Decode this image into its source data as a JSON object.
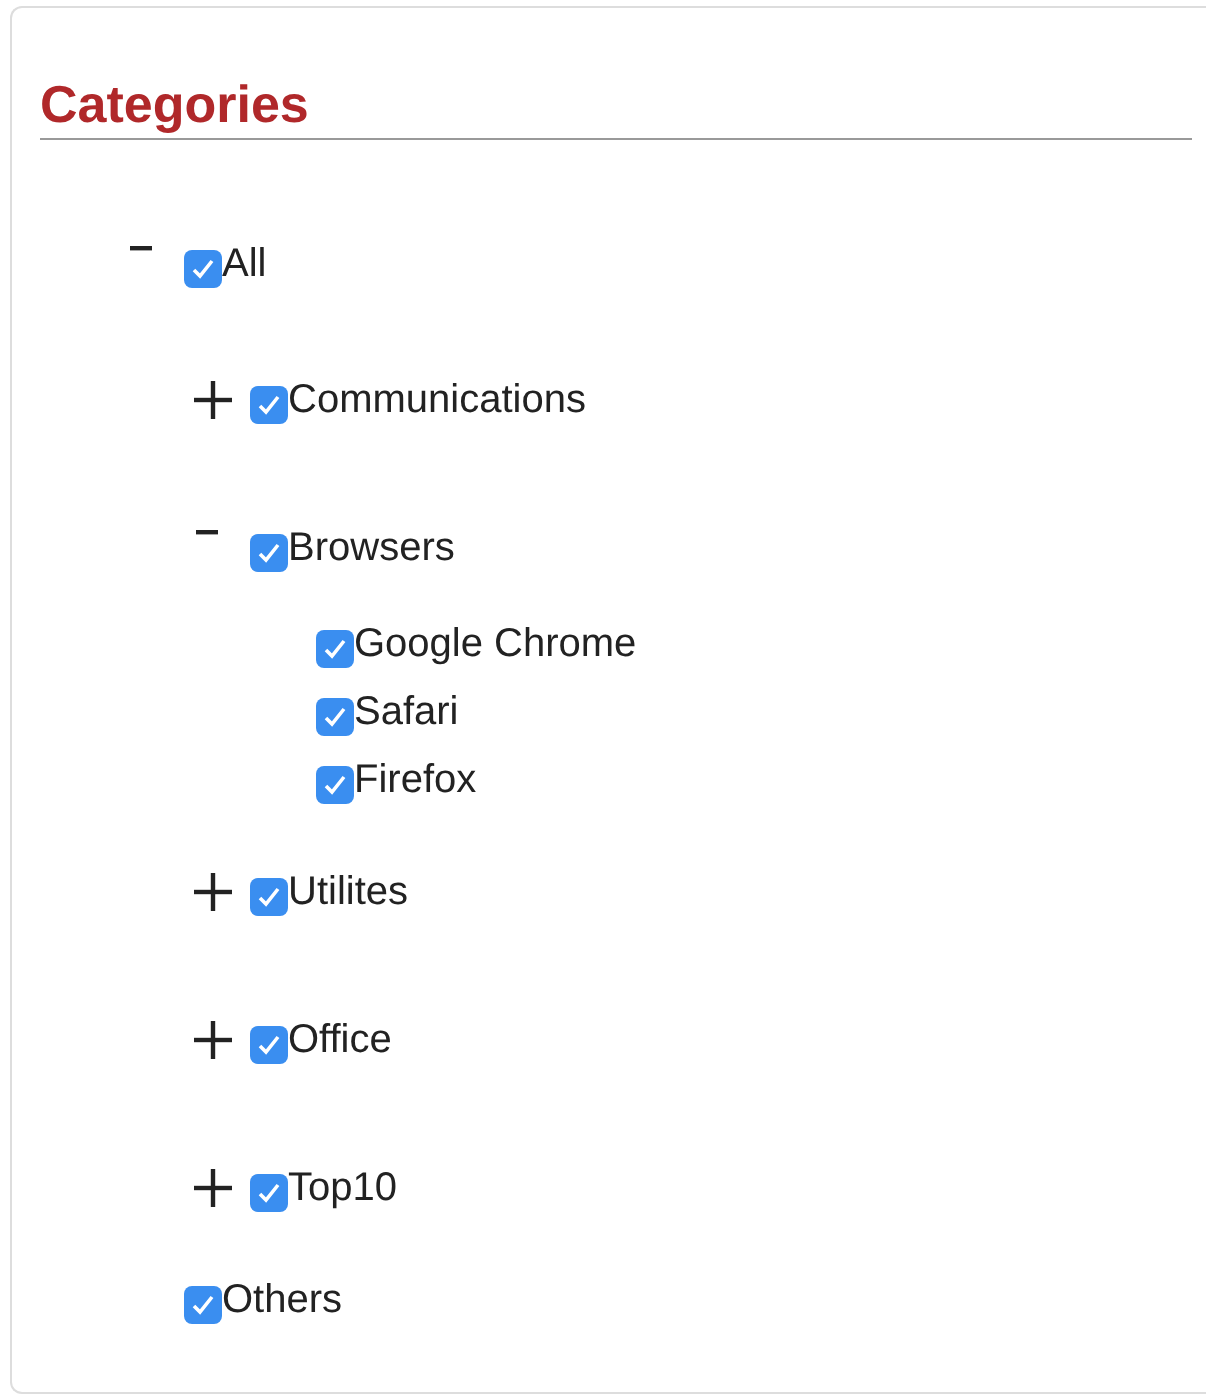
{
  "panel": {
    "title": "Categories",
    "tree": [
      {
        "label": "All",
        "checked": true,
        "expanded": true,
        "children": [
          {
            "label": "Communications",
            "checked": true,
            "expanded": false
          },
          {
            "label": "Browsers",
            "checked": true,
            "expanded": true,
            "children": [
              {
                "label": "Google Chrome",
                "checked": true
              },
              {
                "label": "Safari",
                "checked": true
              },
              {
                "label": "Firefox",
                "checked": true
              }
            ]
          },
          {
            "label": "Utilites",
            "checked": true,
            "expanded": false
          },
          {
            "label": "Office",
            "checked": true,
            "expanded": false
          },
          {
            "label": "Top10",
            "checked": true,
            "expanded": false
          }
        ]
      },
      {
        "label": "Others",
        "checked": true
      }
    ]
  }
}
